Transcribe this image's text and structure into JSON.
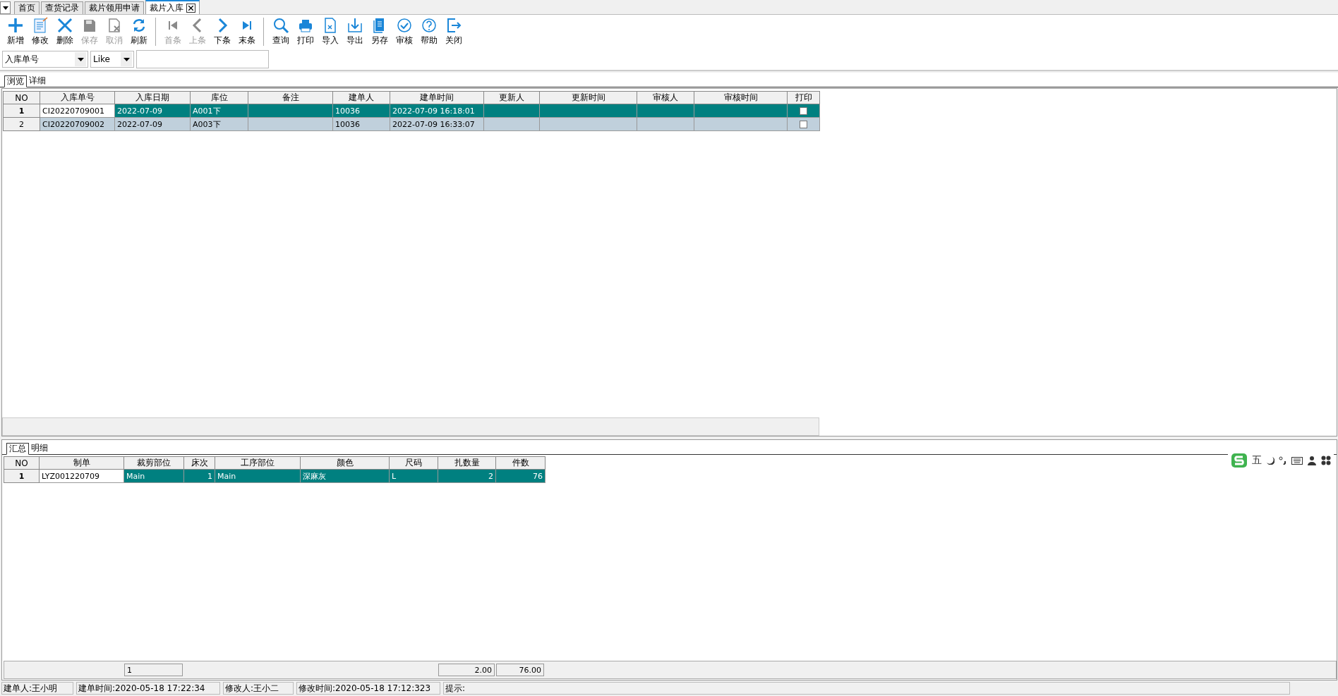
{
  "doc_tabs": [
    {
      "label": "首页",
      "selected": false,
      "closable": false
    },
    {
      "label": "查货记录",
      "selected": false,
      "closable": false
    },
    {
      "label": "裁片领用申请",
      "selected": false,
      "closable": false
    },
    {
      "label": "裁片入库",
      "selected": true,
      "closable": true
    }
  ],
  "toolbar_groups": [
    {
      "buttons": [
        {
          "kind": "add",
          "label": "新增",
          "disabled": false
        },
        {
          "kind": "edit",
          "label": "修改",
          "disabled": false
        },
        {
          "kind": "delete",
          "label": "删除",
          "disabled": false
        },
        {
          "kind": "save",
          "label": "保存",
          "disabled": true
        },
        {
          "kind": "cancel",
          "label": "取消",
          "disabled": true
        },
        {
          "kind": "refresh",
          "label": "刷新",
          "disabled": false
        }
      ]
    },
    {
      "buttons": [
        {
          "kind": "first",
          "label": "首条",
          "disabled": true
        },
        {
          "kind": "prev",
          "label": "上条",
          "disabled": true
        },
        {
          "kind": "next",
          "label": "下条",
          "disabled": false
        },
        {
          "kind": "last",
          "label": "末条",
          "disabled": false
        }
      ]
    },
    {
      "buttons": [
        {
          "kind": "search",
          "label": "查询",
          "disabled": false
        },
        {
          "kind": "print",
          "label": "打印",
          "disabled": false
        },
        {
          "kind": "import",
          "label": "导入",
          "disabled": false
        },
        {
          "kind": "export",
          "label": "导出",
          "disabled": false
        },
        {
          "kind": "saveas",
          "label": "另存",
          "disabled": false
        },
        {
          "kind": "approve",
          "label": "审核",
          "disabled": false
        },
        {
          "kind": "help",
          "label": "帮助",
          "disabled": false
        },
        {
          "kind": "close",
          "label": "关闭",
          "disabled": false
        }
      ]
    }
  ],
  "filter": {
    "field": "入库单号",
    "operator": "Like"
  },
  "view_tabs": [
    {
      "label": "浏览",
      "selected": true
    },
    {
      "label": "详细",
      "selected": false
    }
  ],
  "main_table": {
    "columns": [
      "NO",
      "入库单号",
      "入库日期",
      "库位",
      "备注",
      "建单人",
      "建单时间",
      "更新人",
      "更新时间",
      "审核人",
      "审核时间",
      "打印"
    ],
    "rows": [
      {
        "selected": true,
        "focused": true,
        "cells": [
          "1",
          "CI20220709001",
          "2022-07-09",
          "A001下",
          "",
          "10036",
          "2022-07-09 16:18:01",
          "",
          "",
          "",
          ""
        ],
        "print": false
      },
      {
        "selected": false,
        "focused": false,
        "cells": [
          "2",
          "CI20220709002",
          "2022-07-09",
          "A003下",
          "",
          "10036",
          "2022-07-09 16:33:07",
          "",
          "",
          "",
          ""
        ],
        "print": false
      }
    ]
  },
  "detail_tabs": [
    {
      "label": "汇总",
      "selected": true
    },
    {
      "label": "明细",
      "selected": false
    }
  ],
  "detail_table": {
    "columns": [
      "NO",
      "制单",
      "裁剪部位",
      "床次",
      "工序部位",
      "颜色",
      "尺码",
      "扎数量",
      "件数"
    ],
    "rows": [
      {
        "selected": true,
        "focused": true,
        "cells": [
          "1",
          "LYZ001220709",
          "Main",
          "1",
          "Main",
          "深麻灰",
          "L",
          "2",
          "76"
        ]
      }
    ],
    "totals": [
      "1",
      "2.00",
      "76.00"
    ]
  },
  "ime_bar": {
    "mode": "五"
  },
  "status_bar": [
    "建单人:王小明",
    "建单时间:2020-05-18 17:22:34",
    "修改人:王小二",
    "修改时间:2020-05-18 17:12:323",
    "提示:"
  ]
}
